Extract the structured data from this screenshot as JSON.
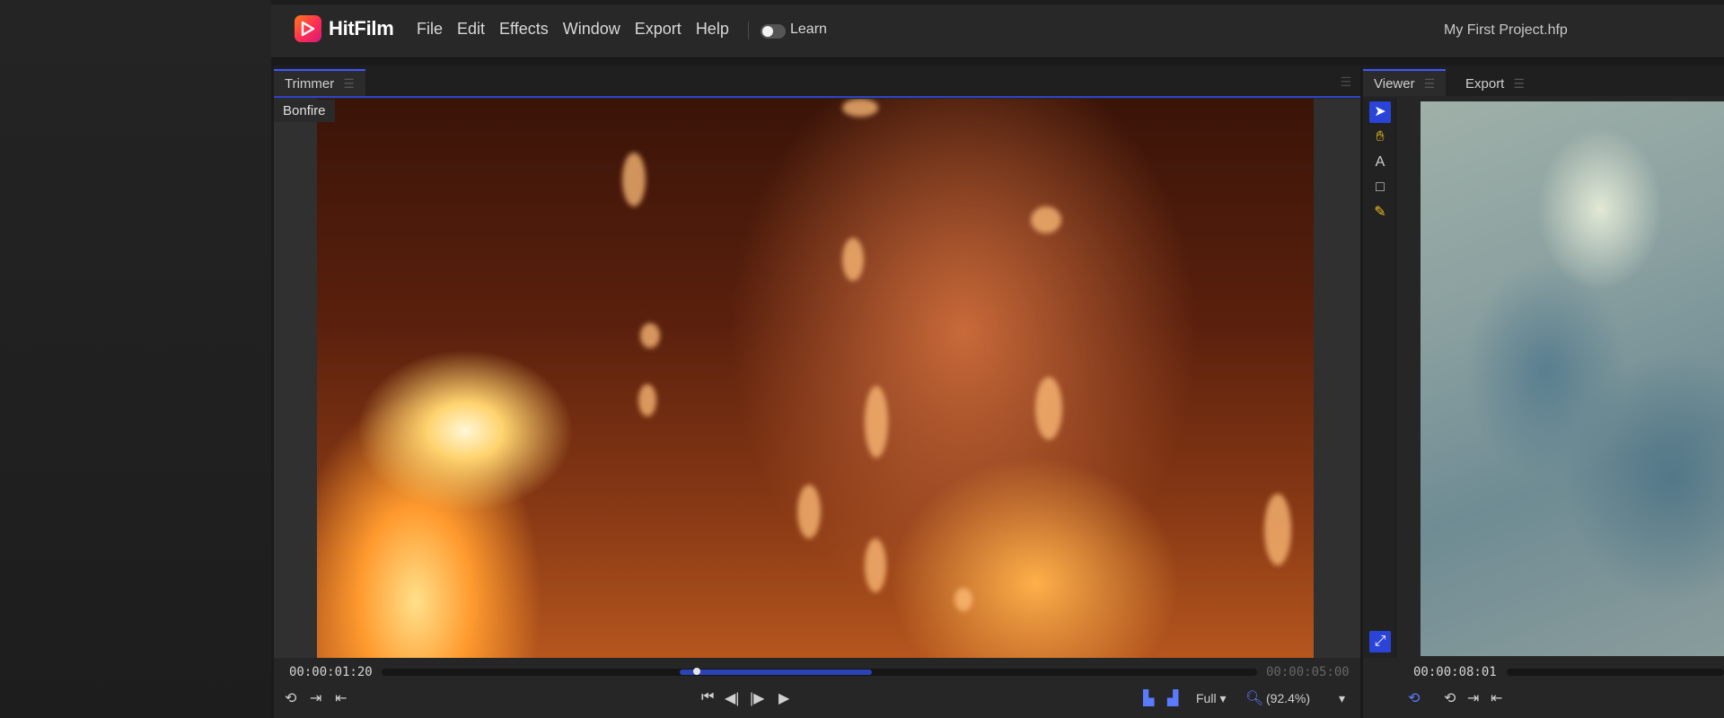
{
  "app": {
    "name": "HitFilm",
    "menu": [
      "File",
      "Edit",
      "Effects",
      "Window",
      "Export",
      "Help"
    ],
    "learn_label": "Learn",
    "project_title": "My First Project.hfp"
  },
  "trimmer": {
    "tab_label": "Trimmer",
    "clip_name": "Bonfire",
    "current_time": "00:00:01:20",
    "duration": "00:00:05:00",
    "quality": "Full",
    "zoom": "(92.4%)",
    "playhead_fraction": 0.36,
    "in_point_fraction": 0.34,
    "out_point_fraction": 0.56
  },
  "viewer": {
    "tabs": [
      "Viewer",
      "Export"
    ],
    "current_time": "00:00:08:01",
    "tools": [
      "select-tool",
      "hand-tool",
      "text-tool",
      "mask-tool",
      "paint-tool"
    ]
  },
  "colors": {
    "accent": "#3d57ff",
    "range": "#2c43b8",
    "logo_start": "#ff7a18",
    "logo_end": "#d61a7a"
  }
}
